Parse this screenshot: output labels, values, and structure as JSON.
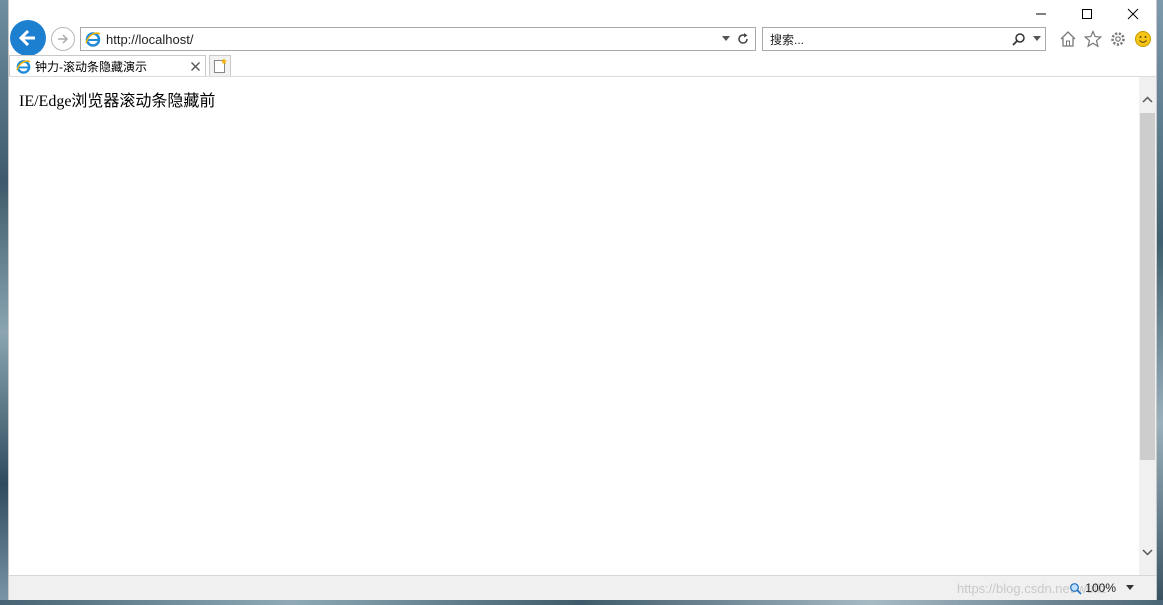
{
  "browser": {
    "address": {
      "url": "http://localhost/"
    },
    "search": {
      "placeholder": "搜索..."
    },
    "tab": {
      "title": "钟力-滚动条隐藏演示"
    }
  },
  "page": {
    "body_text": "IE/Edge浏览器滚动条隐藏前"
  },
  "status": {
    "zoom": "100%",
    "watermark": "https://blog.csdn.net/wufiz"
  },
  "colors": {
    "back_button": "#1c7fd0",
    "ie_icon": "#1f8ad8",
    "smiley": "#f5c518"
  },
  "icons": [
    "back-arrow-icon",
    "forward-arrow-icon",
    "ie-icon",
    "dropdown-icon",
    "refresh-icon",
    "search-icon",
    "home-icon",
    "favorites-star-icon",
    "settings-gear-icon",
    "feedback-smiley-icon",
    "close-tab-icon",
    "new-tab-icon",
    "minimize-icon",
    "maximize-icon",
    "close-icon",
    "zoom-icon"
  ]
}
